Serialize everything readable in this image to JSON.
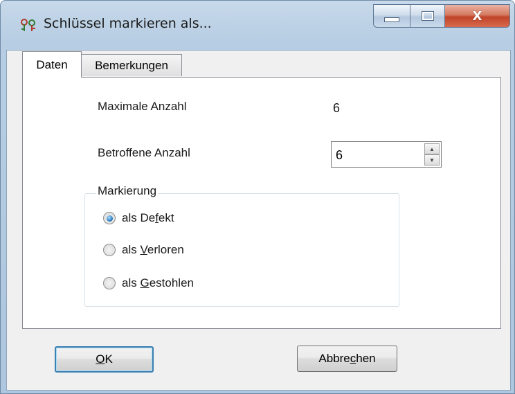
{
  "window": {
    "title": "Schlüssel markieren als...",
    "icon": "keys-app-icon",
    "caption": {
      "minimize": "minimize-icon",
      "maximize": "maximize-icon",
      "close_glyph": "X"
    }
  },
  "tabs": [
    {
      "label": "Daten",
      "active": true
    },
    {
      "label": "Bemerkungen",
      "active": false
    }
  ],
  "fields": {
    "max_label": "Maximale Anzahl",
    "max_value": "6",
    "affected_label": "Betroffene Anzahl",
    "affected_value": "6"
  },
  "marking": {
    "legend": "Markierung",
    "options": [
      {
        "pre": "als De",
        "mnemonic": "f",
        "post": "ekt",
        "selected": true
      },
      {
        "pre": "als ",
        "mnemonic": "V",
        "post": "erloren",
        "selected": false
      },
      {
        "pre": "als ",
        "mnemonic": "G",
        "post": "estohlen",
        "selected": false
      }
    ]
  },
  "buttons": {
    "ok": {
      "mnemonic": "O",
      "rest": "K"
    },
    "cancel": {
      "pre": "Abbre",
      "mnemonic": "c",
      "post": "hen"
    }
  },
  "colors": {
    "title_bar": "#b7cde3",
    "close_button": "#c0442a",
    "default_button_border": "#3c7fb1",
    "radio_selected": "#1c6fb8"
  }
}
